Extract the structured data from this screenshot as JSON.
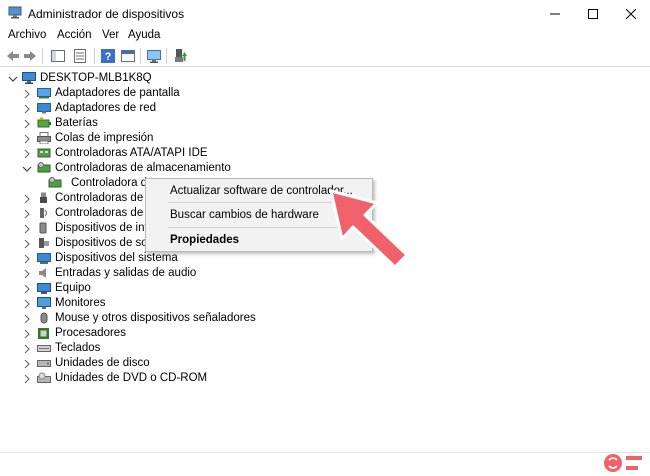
{
  "window": {
    "title": "Administrador de dispositivos"
  },
  "menu": [
    "Archivo",
    "Acción",
    "Ver",
    "Ayuda"
  ],
  "tree": {
    "root": "DESKTOP-MLB1K8Q",
    "items": [
      {
        "label": "Adaptadores de pantalla",
        "icon": "display-adapter-icon"
      },
      {
        "label": "Adaptadores de red",
        "icon": "network-adapter-icon"
      },
      {
        "label": "Baterías",
        "icon": "battery-icon"
      },
      {
        "label": "Colas de impresión",
        "icon": "printer-icon"
      },
      {
        "label": "Controladoras ATA/ATAPI IDE",
        "icon": "ide-controller-icon"
      },
      {
        "label": "Controladoras de almacenamiento",
        "icon": "storage-controller-icon",
        "expanded": true
      },
      {
        "label": "Controladora de",
        "icon": "storage-controller-icon",
        "child": true
      },
      {
        "label": "Controladoras de bu",
        "icon": "usb-controller-icon"
      },
      {
        "label": "Controladoras de so",
        "icon": "sound-controller-icon"
      },
      {
        "label": "Dispositivos de inter",
        "icon": "hid-icon"
      },
      {
        "label": "Dispositivos de softw",
        "icon": "software-device-icon"
      },
      {
        "label": "Dispositivos del sistema",
        "icon": "system-device-icon"
      },
      {
        "label": "Entradas y salidas de audio",
        "icon": "audio-icon"
      },
      {
        "label": "Equipo",
        "icon": "computer-icon"
      },
      {
        "label": "Monitores",
        "icon": "monitor-icon"
      },
      {
        "label": "Mouse y otros dispositivos señaladores",
        "icon": "mouse-icon"
      },
      {
        "label": "Procesadores",
        "icon": "processor-icon"
      },
      {
        "label": "Teclados",
        "icon": "keyboard-icon"
      },
      {
        "label": "Unidades de disco",
        "icon": "disk-drive-icon"
      },
      {
        "label": "Unidades de DVD o CD-ROM",
        "icon": "dvd-drive-icon"
      }
    ]
  },
  "context_menu": {
    "update": "Actualizar software de controlador...",
    "scan": "Buscar cambios de hardware",
    "properties": "Propiedades"
  },
  "colors": {
    "arrow": "#f0616b",
    "watermark": "#f0616b",
    "context_bg": "#f2f2f2"
  }
}
